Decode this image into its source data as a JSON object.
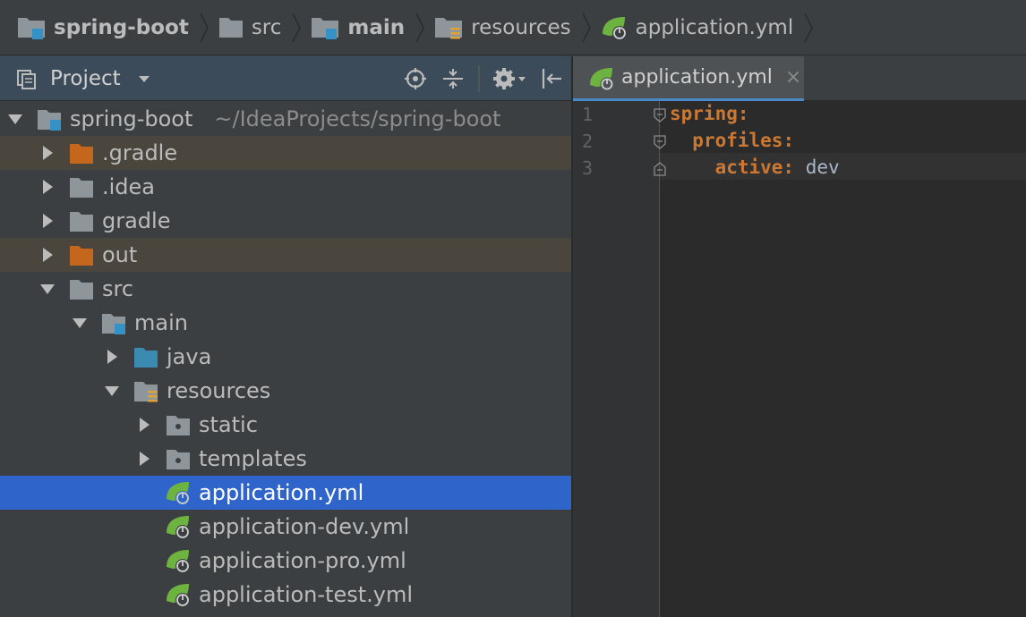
{
  "breadcrumb": {
    "items": [
      {
        "label": "spring-boot",
        "bold": true,
        "icon": "module-folder-icon"
      },
      {
        "label": "src",
        "bold": false,
        "icon": "folder-icon"
      },
      {
        "label": "main",
        "bold": true,
        "icon": "source-root-folder-icon"
      },
      {
        "label": "resources",
        "bold": false,
        "icon": "resources-folder-icon"
      },
      {
        "label": "application.yml",
        "bold": false,
        "icon": "spring-yaml-icon"
      }
    ]
  },
  "project": {
    "title": "Project",
    "tree": [
      {
        "label": "spring-boot",
        "path": "~/IdeaProjects/spring-boot",
        "level": 0,
        "arrow": "down",
        "icon": "module",
        "state": ""
      },
      {
        "label": ".gradle",
        "level": 1,
        "arrow": "right",
        "icon": "orange",
        "state": "excluded"
      },
      {
        "label": ".idea",
        "level": 1,
        "arrow": "right",
        "icon": "folder",
        "state": ""
      },
      {
        "label": "gradle",
        "level": 1,
        "arrow": "right",
        "icon": "folder",
        "state": ""
      },
      {
        "label": "out",
        "level": 1,
        "arrow": "right",
        "icon": "orange",
        "state": "excluded"
      },
      {
        "label": "src",
        "level": 1,
        "arrow": "down",
        "icon": "folder",
        "state": ""
      },
      {
        "label": "main",
        "level": 2,
        "arrow": "down",
        "icon": "module",
        "state": ""
      },
      {
        "label": "java",
        "level": 3,
        "arrow": "right",
        "icon": "blue",
        "state": ""
      },
      {
        "label": "resources",
        "level": 3,
        "arrow": "down",
        "icon": "resources",
        "state": ""
      },
      {
        "label": "static",
        "level": 4,
        "arrow": "right",
        "icon": "dotfolder",
        "state": ""
      },
      {
        "label": "templates",
        "level": 4,
        "arrow": "right",
        "icon": "dotfolder",
        "state": ""
      },
      {
        "label": "application.yml",
        "level": 4,
        "arrow": "none",
        "icon": "spring",
        "state": "selected"
      },
      {
        "label": "application-dev.yml",
        "level": 4,
        "arrow": "none",
        "icon": "spring",
        "state": ""
      },
      {
        "label": "application-pro.yml",
        "level": 4,
        "arrow": "none",
        "icon": "spring",
        "state": ""
      },
      {
        "label": "application-test.yml",
        "level": 4,
        "arrow": "none",
        "icon": "spring",
        "state": ""
      }
    ]
  },
  "editor": {
    "tab": {
      "label": "application.yml",
      "close": "×"
    },
    "lines": [
      {
        "num": "1",
        "key": "spring:",
        "value": "",
        "indent": ""
      },
      {
        "num": "2",
        "key": "profiles:",
        "value": "",
        "indent": "  "
      },
      {
        "num": "3",
        "key": "active:",
        "value": " dev",
        "indent": "    "
      }
    ]
  },
  "colors": {
    "selection": "#2f65ca",
    "excluded_folder": "#c4661c",
    "spring_leaf": "#6db33f",
    "yaml_key": "#cc7832"
  }
}
